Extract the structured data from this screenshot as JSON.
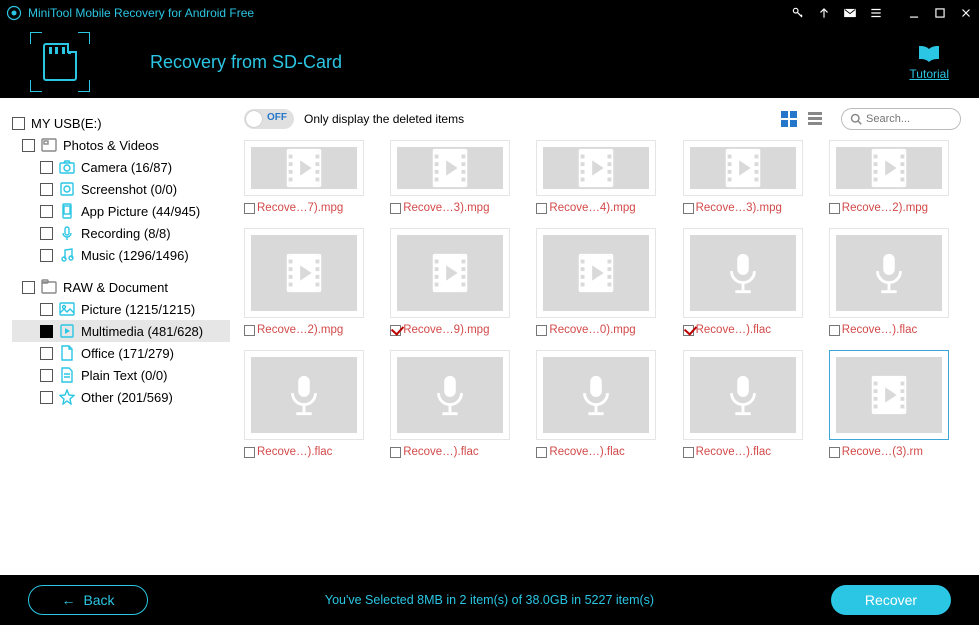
{
  "titlebar": {
    "title": "MiniTool Mobile Recovery for Android Free"
  },
  "header": {
    "heading": "Recovery from SD-Card",
    "tutorial": "Tutorial"
  },
  "sidebar": {
    "root_label": "MY USB(E:)",
    "section_pv": "Photos & Videos",
    "section_rd": "RAW & Document",
    "items_pv": [
      {
        "label": "Camera (16/87)",
        "icon": "camera"
      },
      {
        "label": "Screenshot (0/0)",
        "icon": "screenshot"
      },
      {
        "label": "App Picture (44/945)",
        "icon": "apppic"
      },
      {
        "label": "Recording (8/8)",
        "icon": "recording"
      },
      {
        "label": "Music (1296/1496)",
        "icon": "music"
      }
    ],
    "items_rd": [
      {
        "label": "Picture (1215/1215)",
        "icon": "picture"
      },
      {
        "label": "Multimedia (481/628)",
        "icon": "multimedia",
        "selected": true
      },
      {
        "label": "Office (171/279)",
        "icon": "office"
      },
      {
        "label": "Plain Text (0/0)",
        "icon": "plaintext"
      },
      {
        "label": "Other (201/569)",
        "icon": "other"
      }
    ]
  },
  "toolbar": {
    "toggle_label": "OFF",
    "toggle_text": "Only display the deleted items",
    "search_placeholder": "Search..."
  },
  "grid": {
    "items": [
      {
        "type": "video",
        "name": "Recove…7).mpg",
        "checked": false,
        "row": 0
      },
      {
        "type": "video",
        "name": "Recove…3).mpg",
        "checked": false,
        "row": 0
      },
      {
        "type": "video",
        "name": "Recove…4).mpg",
        "checked": false,
        "row": 0
      },
      {
        "type": "video",
        "name": "Recove…3).mpg",
        "checked": false,
        "row": 0
      },
      {
        "type": "video",
        "name": "Recove…2).mpg",
        "checked": false,
        "row": 0
      },
      {
        "type": "video",
        "name": "Recove…2).mpg",
        "checked": false,
        "row": 1
      },
      {
        "type": "video",
        "name": "Recove…9).mpg",
        "checked": true,
        "row": 1
      },
      {
        "type": "video",
        "name": "Recove…0).mpg",
        "checked": false,
        "row": 1
      },
      {
        "type": "audio",
        "name": "Recove…).flac",
        "checked": true,
        "row": 1
      },
      {
        "type": "audio",
        "name": "Recove…).flac",
        "checked": false,
        "row": 1
      },
      {
        "type": "audio",
        "name": "Recove…).flac",
        "checked": false,
        "row": 2
      },
      {
        "type": "audio",
        "name": "Recove…).flac",
        "checked": false,
        "row": 2
      },
      {
        "type": "audio",
        "name": "Recove…).flac",
        "checked": false,
        "row": 2
      },
      {
        "type": "audio",
        "name": "Recove…).flac",
        "checked": false,
        "row": 2
      },
      {
        "type": "video",
        "name": "Recove…(3).rm",
        "checked": false,
        "row": 2,
        "selected": true
      }
    ]
  },
  "footer": {
    "back": "Back",
    "status": "You've Selected 8MB in 2 item(s) of 38.0GB in 5227 item(s)",
    "recover": "Recover"
  },
  "colors": {
    "accent": "#2bc6e3",
    "deleted": "#d34949"
  }
}
